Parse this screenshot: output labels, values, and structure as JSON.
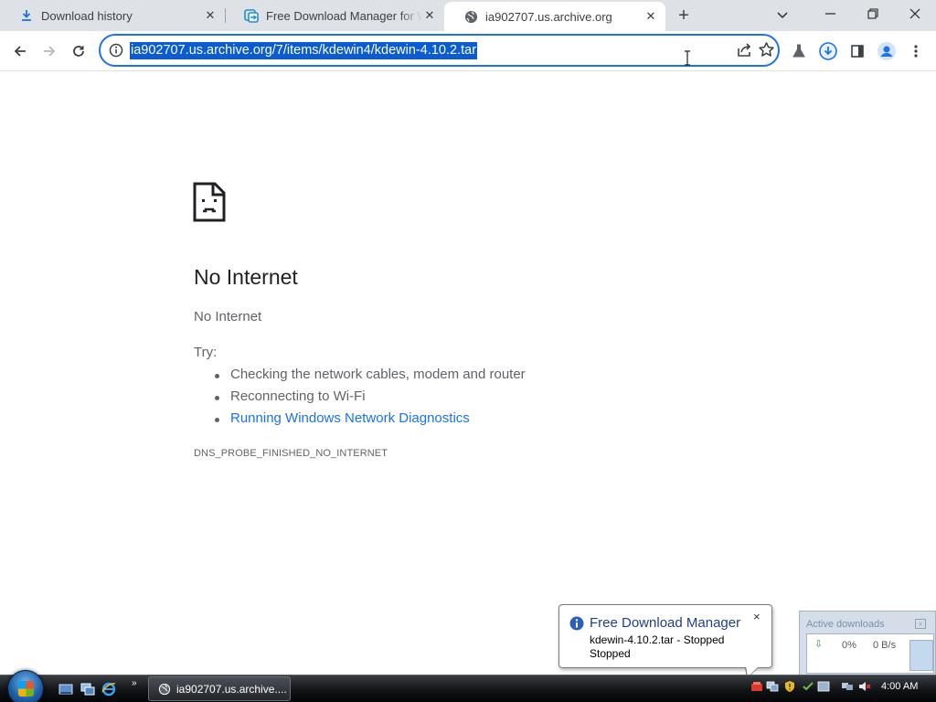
{
  "browser": {
    "tabs": [
      {
        "title": "Download history",
        "icon": "download-icon",
        "active": false
      },
      {
        "title": "Free Download Manager for Windows",
        "icon": "fdm-icon",
        "active": false
      },
      {
        "title": "ia902707.us.archive.org",
        "icon": "globe-icon",
        "active": true
      }
    ],
    "new_tab": "+",
    "url": "ia902707.us.archive.org/7/items/kdewin4/kdewin-4.10.2.tar"
  },
  "page": {
    "icon": "sad-page-icon",
    "heading": "No Internet",
    "subtext": "No Internet",
    "try_label": "Try:",
    "suggestions": [
      "Checking the network cables, modem and router",
      "Reconnecting to Wi-Fi",
      "Running Windows Network Diagnostics"
    ],
    "error_code": "DNS_PROBE_FINISHED_NO_INTERNET"
  },
  "notification": {
    "title": "Free Download Manager",
    "line1": "kdewin-4.10.2.tar - Stopped",
    "line2": "Stopped",
    "close": "×"
  },
  "active_downloads": {
    "title": "Active downloads",
    "percent": "0%",
    "speed": "0 B/s"
  },
  "taskbar": {
    "task_label": "ia902707.us.archive....",
    "more": "»",
    "clock": "4:00 AM"
  },
  "colors": {
    "accent": "#1a73e8",
    "selection": "#0b5bd3",
    "tabstrip": "#dee1e6"
  }
}
